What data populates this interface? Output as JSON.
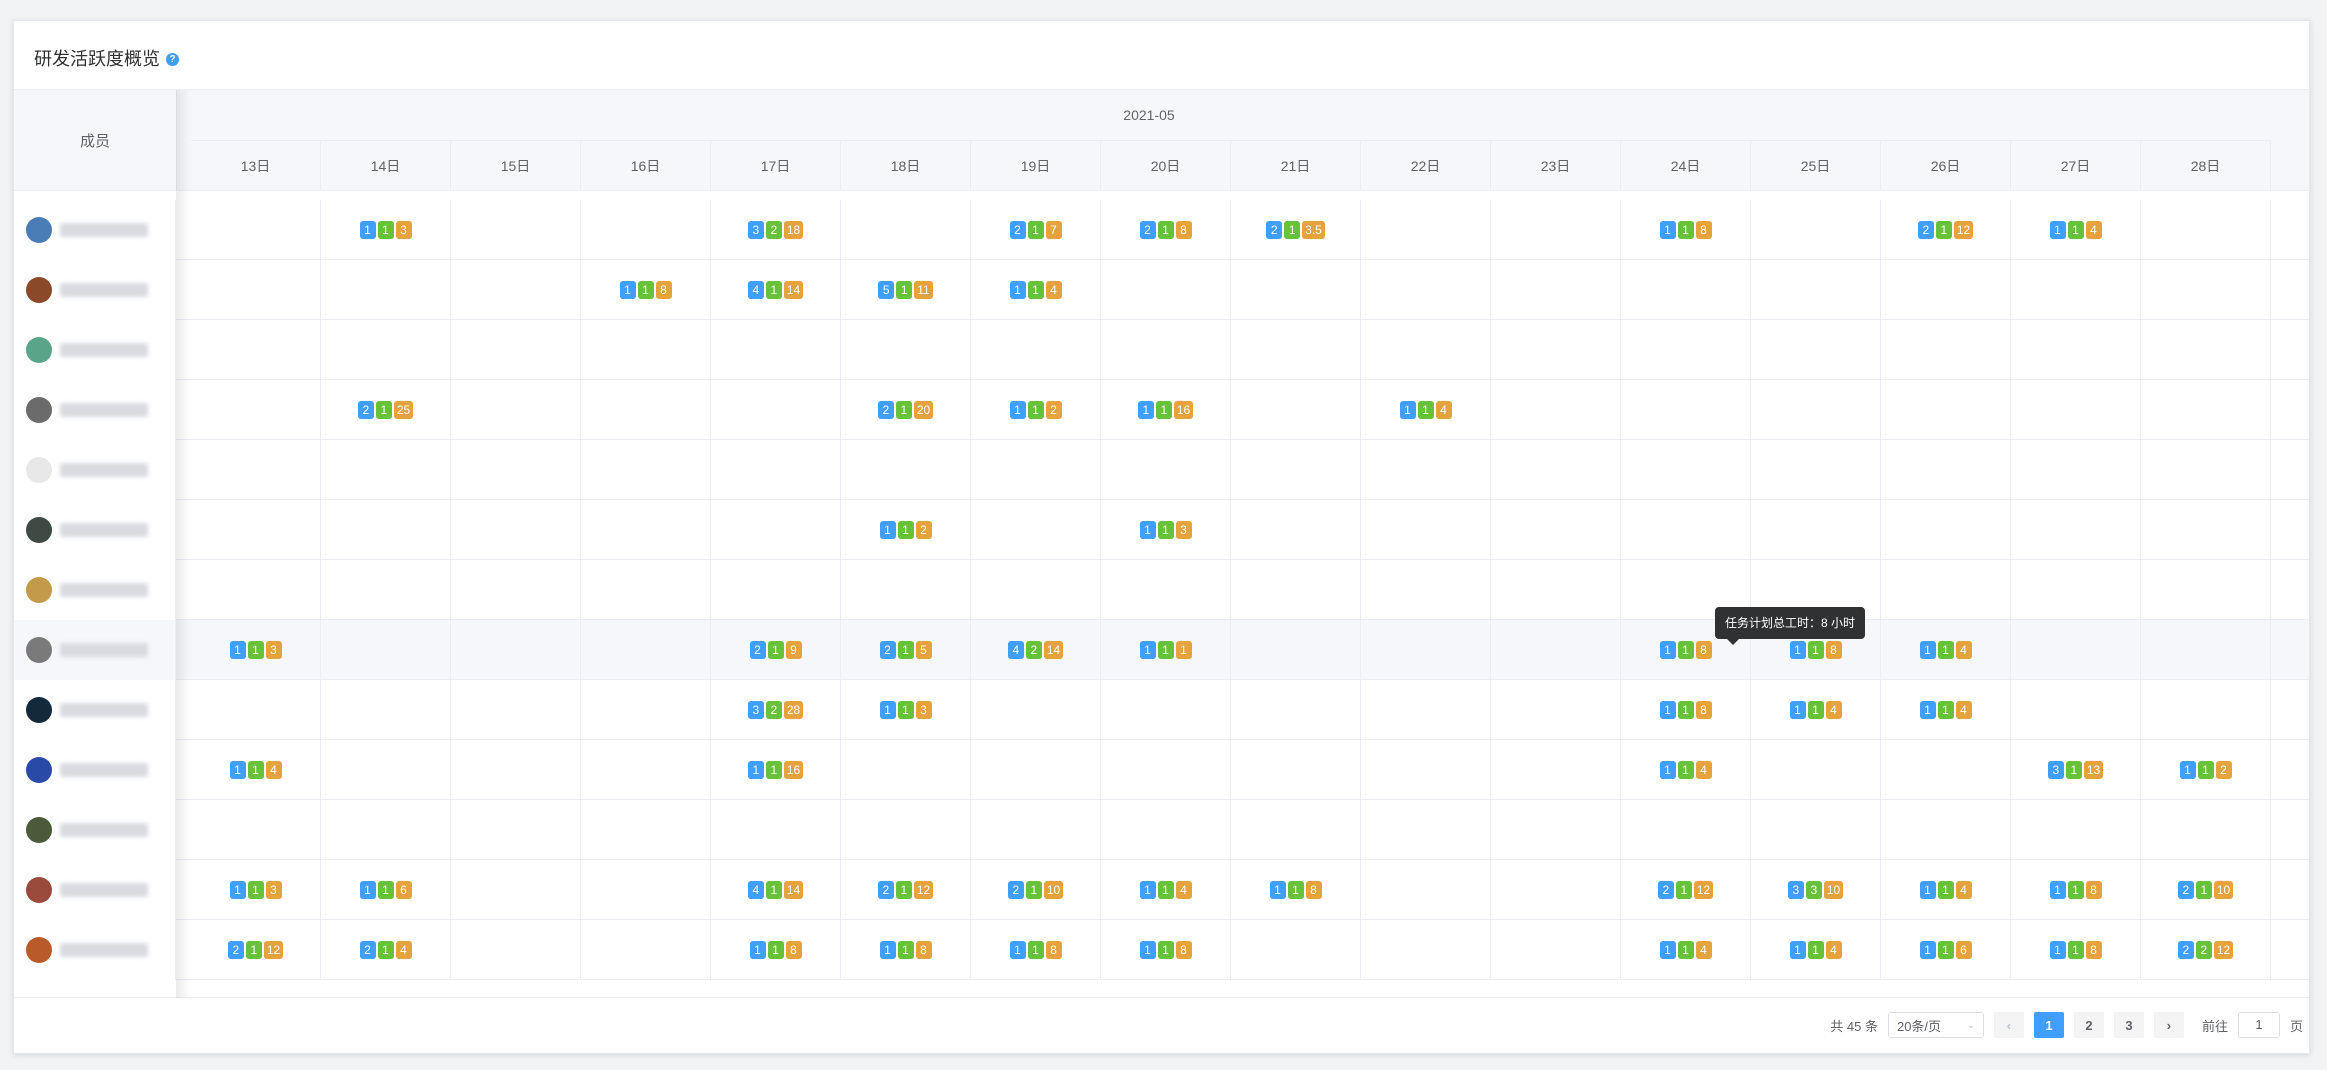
{
  "header": {
    "title": "研发活跃度概览",
    "help_icon": "question-icon"
  },
  "table": {
    "member_column": "成员",
    "month": "2021-05",
    "days": [
      "13日",
      "14日",
      "15日",
      "16日",
      "17日",
      "18日",
      "19日",
      "20日",
      "21日",
      "22日",
      "23日",
      "24日",
      "25日",
      "26日",
      "27日",
      "28日"
    ],
    "rows": [
      {
        "avatar_color": "#4a7db5",
        "cells": [
          null,
          [
            "1",
            "1",
            "3"
          ],
          null,
          null,
          [
            "3",
            "2",
            "18"
          ],
          null,
          [
            "2",
            "1",
            "7"
          ],
          [
            "2",
            "1",
            "8"
          ],
          [
            "2",
            "1",
            "3.5"
          ],
          null,
          null,
          [
            "1",
            "1",
            "8"
          ],
          null,
          [
            "2",
            "1",
            "12"
          ],
          [
            "1",
            "1",
            "4"
          ],
          null
        ]
      },
      {
        "avatar_color": "#8a4a2a",
        "cells": [
          null,
          null,
          null,
          [
            "1",
            "1",
            "8"
          ],
          [
            "4",
            "1",
            "14"
          ],
          [
            "5",
            "1",
            "11"
          ],
          [
            "1",
            "1",
            "4"
          ],
          null,
          null,
          null,
          null,
          null,
          null,
          null,
          null,
          null
        ]
      },
      {
        "avatar_color": "#5aa48a",
        "cells": [
          null,
          null,
          null,
          null,
          null,
          null,
          null,
          null,
          null,
          null,
          null,
          null,
          null,
          null,
          null,
          null
        ]
      },
      {
        "avatar_color": "#6b6b6b",
        "cells": [
          null,
          [
            "2",
            "1",
            "25"
          ],
          null,
          null,
          null,
          [
            "2",
            "1",
            "20"
          ],
          [
            "1",
            "1",
            "2"
          ],
          [
            "1",
            "1",
            "16"
          ],
          null,
          [
            "1",
            "1",
            "4"
          ],
          null,
          null,
          null,
          null,
          null,
          null
        ]
      },
      {
        "avatar_color": "#e8e8e8",
        "cells": [
          null,
          null,
          null,
          null,
          null,
          null,
          null,
          null,
          null,
          null,
          null,
          null,
          null,
          null,
          null,
          null
        ]
      },
      {
        "avatar_color": "#3f4a45",
        "cells": [
          null,
          null,
          null,
          null,
          null,
          [
            "1",
            "1",
            "2"
          ],
          null,
          [
            "1",
            "1",
            "3"
          ],
          null,
          null,
          null,
          null,
          null,
          null,
          null,
          null
        ]
      },
      {
        "avatar_color": "#c29a4a",
        "cells": [
          null,
          null,
          null,
          null,
          null,
          null,
          null,
          null,
          null,
          null,
          null,
          null,
          null,
          null,
          null,
          null
        ]
      },
      {
        "avatar_color": "#7a7a7a",
        "highlight": true,
        "cells": [
          [
            "1",
            "1",
            "3"
          ],
          null,
          null,
          null,
          [
            "2",
            "1",
            "9"
          ],
          [
            "2",
            "1",
            "5"
          ],
          [
            "4",
            "2",
            "14"
          ],
          [
            "1",
            "1",
            "1"
          ],
          null,
          null,
          null,
          [
            "1",
            "1",
            "8"
          ],
          [
            "1",
            "1",
            "8"
          ],
          [
            "1",
            "1",
            "4"
          ],
          null,
          null
        ]
      },
      {
        "avatar_color": "#142a3a",
        "cells": [
          null,
          null,
          null,
          null,
          [
            "3",
            "2",
            "28"
          ],
          [
            "1",
            "1",
            "3"
          ],
          null,
          null,
          null,
          null,
          null,
          [
            "1",
            "1",
            "8"
          ],
          [
            "1",
            "1",
            "4"
          ],
          [
            "1",
            "1",
            "4"
          ],
          null,
          null
        ]
      },
      {
        "avatar_color": "#2a4aa8",
        "cells": [
          [
            "1",
            "1",
            "4"
          ],
          null,
          null,
          null,
          [
            "1",
            "1",
            "16"
          ],
          null,
          null,
          null,
          null,
          null,
          null,
          [
            "1",
            "1",
            "4"
          ],
          null,
          null,
          [
            "3",
            "1",
            "13"
          ],
          [
            "1",
            "1",
            "2"
          ]
        ]
      },
      {
        "avatar_color": "#4a5a3a",
        "cells": [
          null,
          null,
          null,
          null,
          null,
          null,
          null,
          null,
          null,
          null,
          null,
          null,
          null,
          null,
          null,
          null
        ]
      },
      {
        "avatar_color": "#9a4a3a",
        "cells": [
          [
            "1",
            "1",
            "3"
          ],
          [
            "1",
            "1",
            "6"
          ],
          null,
          null,
          [
            "4",
            "1",
            "14"
          ],
          [
            "2",
            "1",
            "12"
          ],
          [
            "2",
            "1",
            "10"
          ],
          [
            "1",
            "1",
            "4"
          ],
          [
            "1",
            "1",
            "8"
          ],
          null,
          null,
          [
            "2",
            "1",
            "12"
          ],
          [
            "3",
            "3",
            "10"
          ],
          [
            "1",
            "1",
            "4"
          ],
          [
            "1",
            "1",
            "8"
          ],
          [
            "2",
            "1",
            "10"
          ]
        ]
      },
      {
        "avatar_color": "#b85a2a",
        "cells": [
          [
            "2",
            "1",
            "12"
          ],
          [
            "2",
            "1",
            "4"
          ],
          null,
          null,
          [
            "1",
            "1",
            "8"
          ],
          [
            "1",
            "1",
            "8"
          ],
          [
            "1",
            "1",
            "8"
          ],
          [
            "1",
            "1",
            "8"
          ],
          null,
          null,
          null,
          [
            "1",
            "1",
            "4"
          ],
          [
            "1",
            "1",
            "4"
          ],
          [
            "1",
            "1",
            "6"
          ],
          [
            "1",
            "1",
            "8"
          ],
          [
            "2",
            "2",
            "12"
          ]
        ]
      }
    ]
  },
  "tooltip": {
    "text": "任务计划总工时：8 小时"
  },
  "pagination": {
    "total": "共 45 条",
    "page_size": "20条/页",
    "pages": [
      "1",
      "2",
      "3"
    ],
    "current_page": "1",
    "prev_icon": "chevron-left-icon",
    "next_icon": "chevron-right-icon",
    "jump_prefix": "前往",
    "jump_value": "1",
    "jump_suffix": "页"
  },
  "colors": {
    "blue": "#409eff",
    "green": "#67c23a",
    "orange": "#e6a23c",
    "accent": "#409eff"
  }
}
